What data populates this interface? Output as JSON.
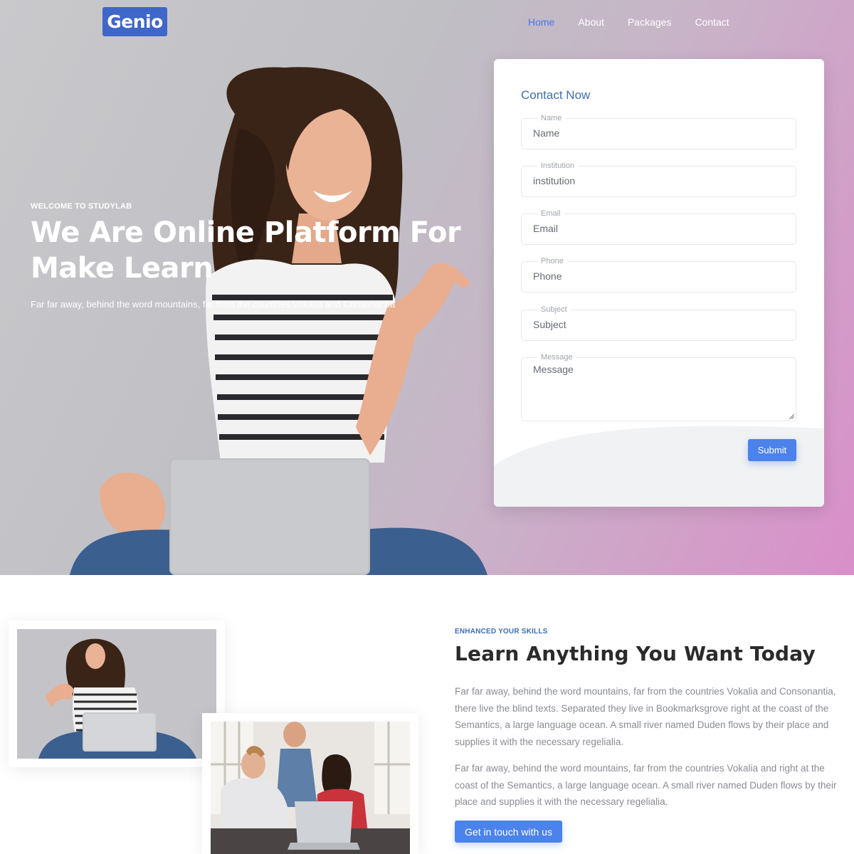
{
  "brand": {
    "logo": "Genio"
  },
  "nav": {
    "items": [
      {
        "label": "Home",
        "active": true
      },
      {
        "label": "About",
        "active": false
      },
      {
        "label": "Packages",
        "active": false
      },
      {
        "label": "Contact",
        "active": false
      }
    ]
  },
  "hero": {
    "kicker": "WELCOME TO STUDYLAB",
    "title": "We Are Online Platform For Make Learn",
    "subtitle": "Far far away, behind the word mountains, far from the countries Vokalia and Consonantia"
  },
  "contact_form": {
    "title": "Contact Now",
    "fields": {
      "name": {
        "legend": "Name",
        "placeholder": "Name"
      },
      "institution": {
        "legend": "Institution",
        "placeholder": "institution"
      },
      "email": {
        "legend": "Email",
        "placeholder": "Email"
      },
      "phone": {
        "legend": "Phone",
        "placeholder": "Phone"
      },
      "subject": {
        "legend": "Subject",
        "placeholder": "Subject"
      },
      "message": {
        "legend": "Message",
        "placeholder": "Message"
      }
    },
    "submit_label": "Submit"
  },
  "about": {
    "kicker": "ENHANCED YOUR SKILLS",
    "title": "Learn Anything You Want Today",
    "paragraph_1": "Far far away, behind the word mountains, far from the countries Vokalia and Consonantia, there live the blind texts. Separated they live in Bookmarksgrove right at the coast of the Semantics, a large language ocean. A small river named Duden flows by their place and supplies it with the necessary regelialia.",
    "paragraph_2": "Far far away, behind the word mountains, far from the countries Vokalia and right at the coast of the Semantics, a large language ocean. A small river named Duden flows by their place and supplies it with the necessary regelialia.",
    "cta_label": "Get in touch with us"
  },
  "colors": {
    "accent": "#4b82eb",
    "logo_bg": "#3f66c9",
    "heading_blue": "#3f6fb0",
    "hero_gradient_end": "#d98fc9"
  }
}
